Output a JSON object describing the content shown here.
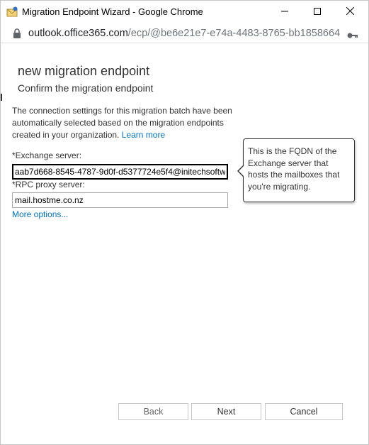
{
  "window": {
    "title": "Migration Endpoint Wizard - Google Chrome",
    "app_icon": "envelope-icon",
    "controls": [
      "minimize-icon",
      "maximize-icon",
      "close-icon"
    ]
  },
  "address_bar": {
    "host": "outlook.office365.com",
    "path": "/ecp/@be6e21e7-e74a-4483-8765-bb1858664...",
    "icons": [
      "lock-icon",
      "key-icon"
    ]
  },
  "page": {
    "heading": "new migration endpoint",
    "subheading": "Confirm the migration endpoint",
    "description": "The connection settings for this migration batch have been automatically selected based on the migration endpoints created in your organization.",
    "learn_more": "Learn more",
    "exchange_server": {
      "label": "*Exchange server:",
      "value": "aab7d668-8545-4787-9d0f-d5377724e5f4@initechsoftw"
    },
    "rpc_proxy_server": {
      "label": "*RPC proxy server:",
      "value": "mail.hostme.co.nz"
    },
    "more_options": "More options...",
    "tooltip": "This is the FQDN of the Exchange server that hosts the mailboxes that you're migrating."
  },
  "footer": {
    "back": "Back",
    "next": "Next",
    "cancel": "Cancel"
  },
  "colors": {
    "link": "#0072c6",
    "text": "#333333",
    "border": "#ababab"
  }
}
